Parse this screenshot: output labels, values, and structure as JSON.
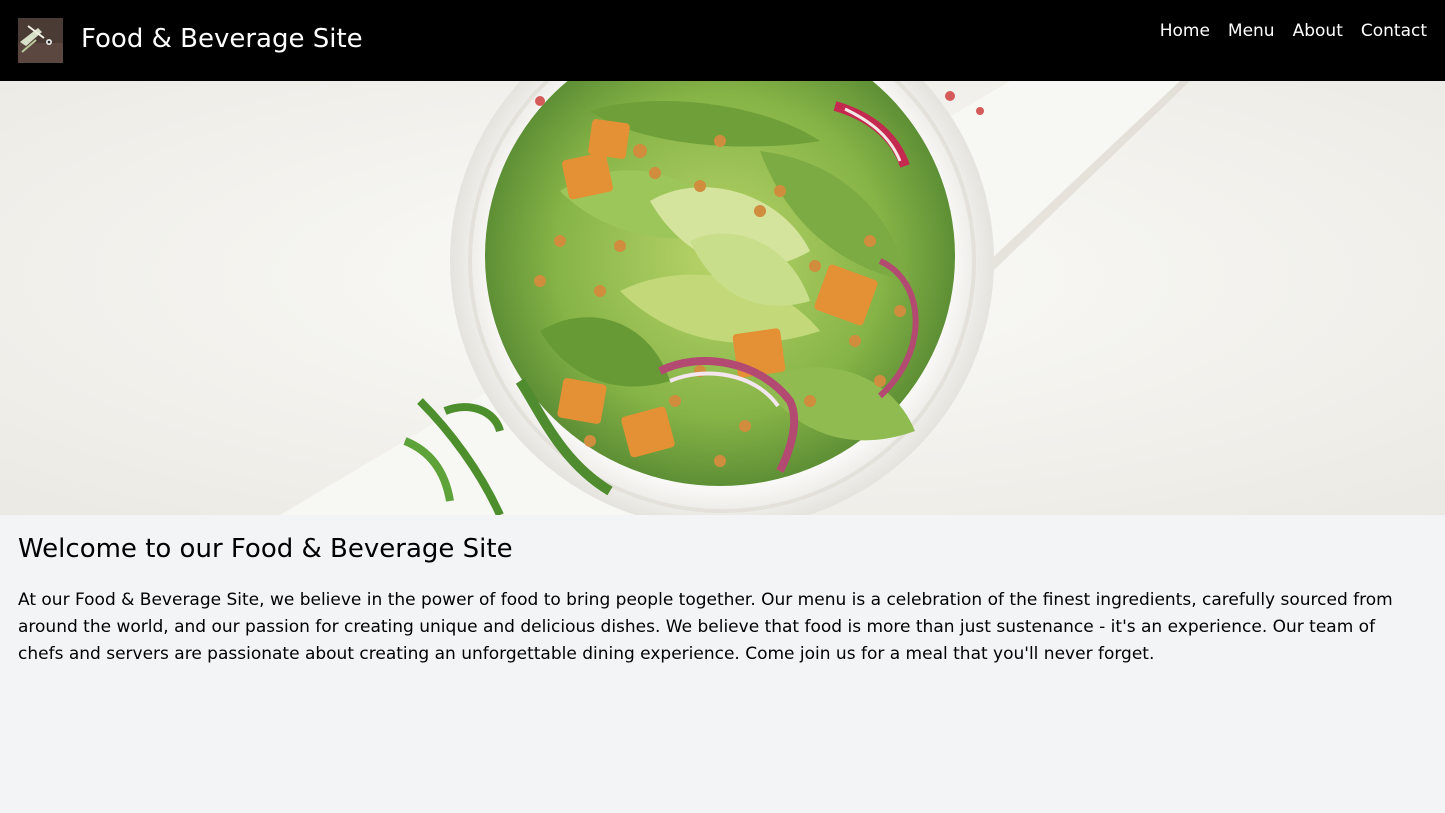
{
  "header": {
    "logo_icon": "salad-thumbnail-icon",
    "title": "Food & Beverage Site",
    "nav": [
      "Home",
      "Menu",
      "About",
      "Contact"
    ]
  },
  "hero": {
    "image_icon": "salad-bowl-photo"
  },
  "main": {
    "heading": "Welcome to our Food & Beverage Site",
    "body": "At our Food & Beverage Site, we believe in the power of food to bring people together. Our menu is a celebration of the finest ingredients, carefully sourced from around the world, and our passion for creating unique and delicious dishes. We believe that food is more than just sustenance - it's an experience. Our team of chefs and servers are passionate about creating an unforgettable dining experience. Come join us for a meal that you'll never forget."
  },
  "colors": {
    "header_bg": "#000000",
    "page_bg": "#f3f4f6",
    "text": "#000000",
    "header_text": "#ffffff"
  }
}
